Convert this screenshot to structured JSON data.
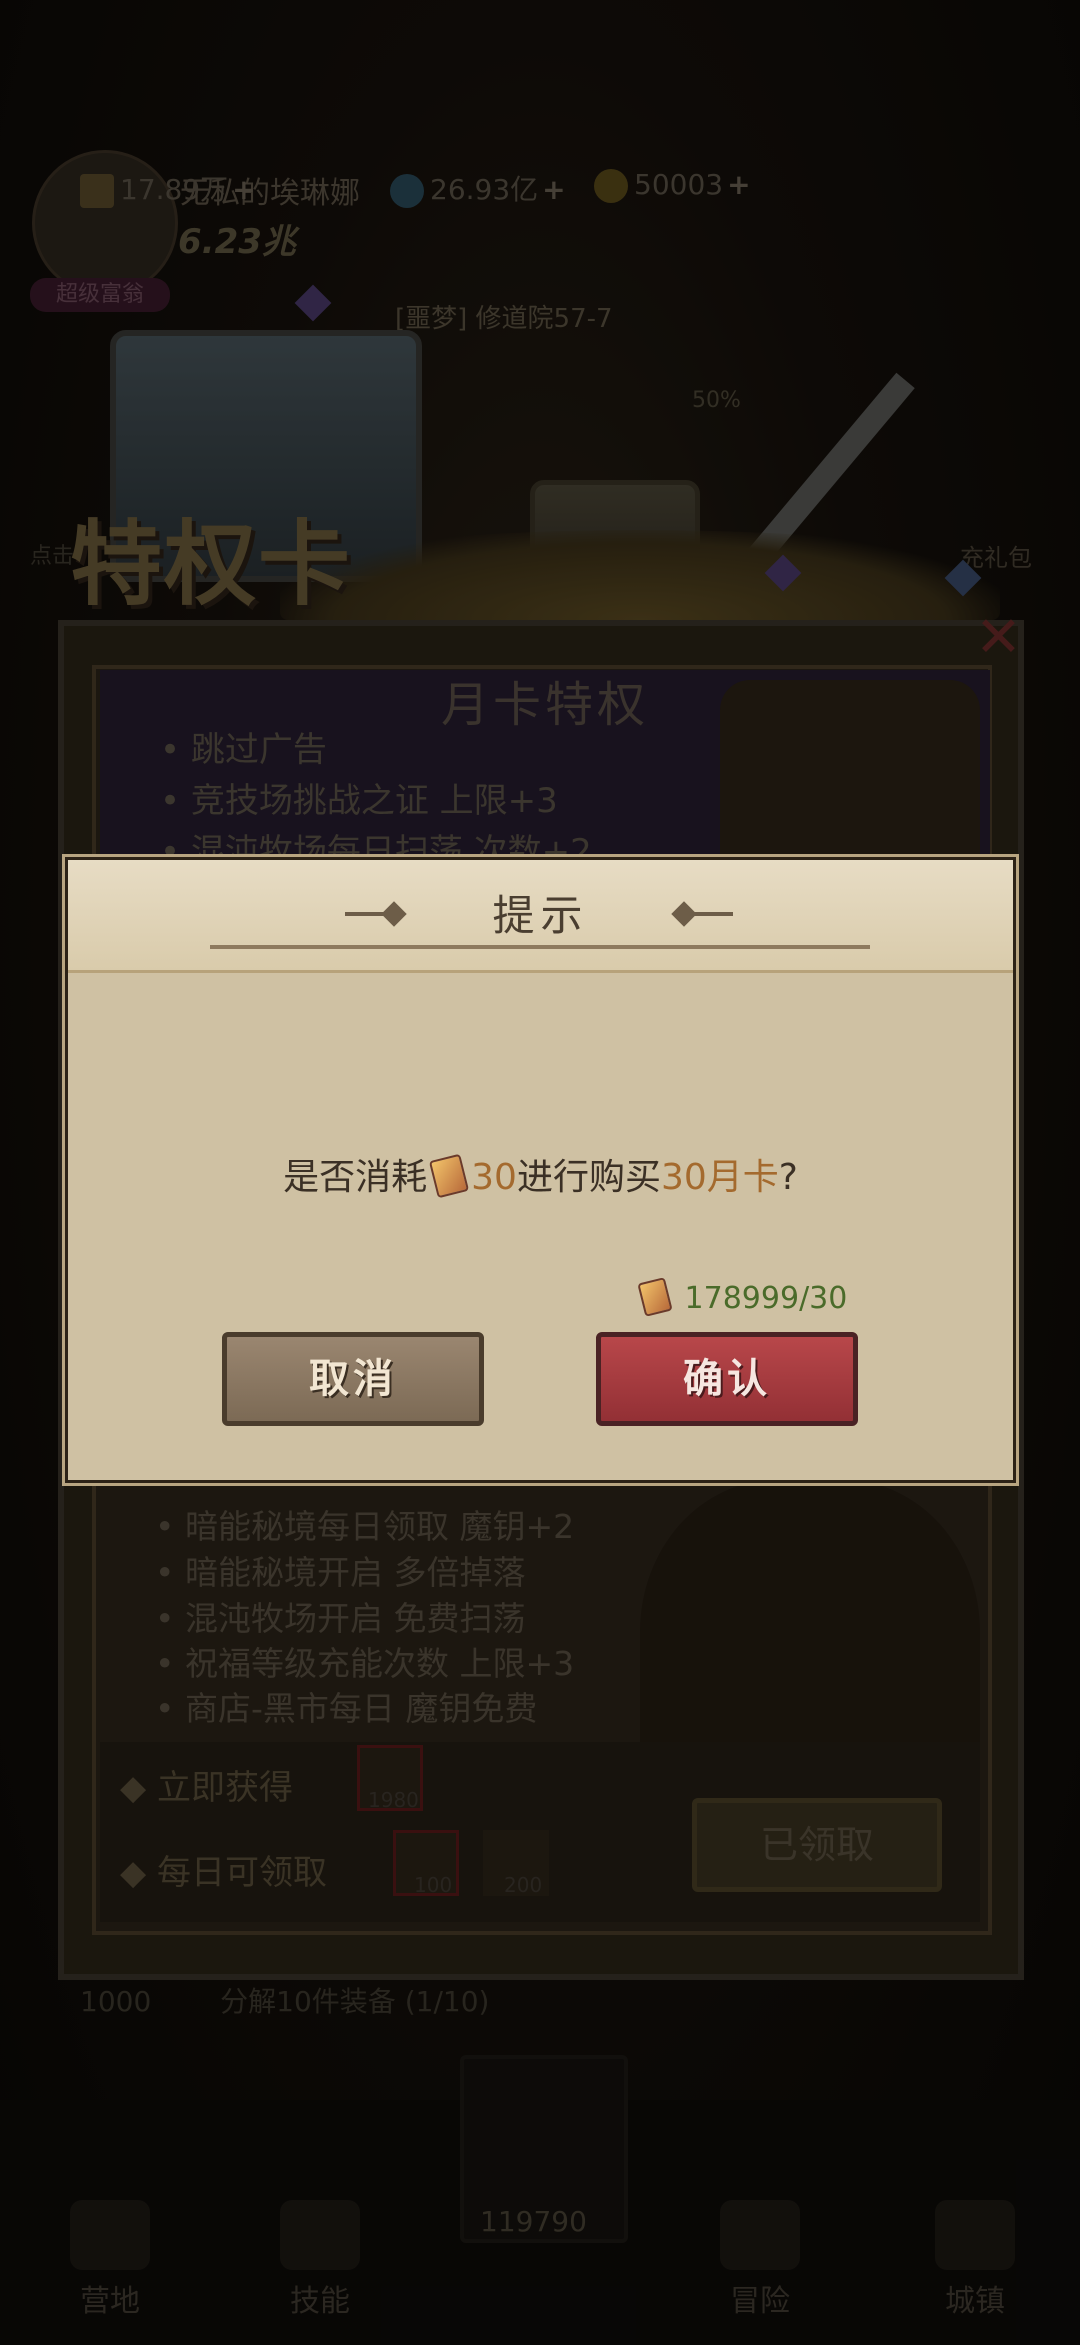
{
  "player": {
    "name": "无私的埃琳娜",
    "power": "6.23兆",
    "badge": "超级富翁",
    "tickets": "17.89万",
    "diamonds": "26.93亿",
    "coins": "50003"
  },
  "stage": "[噩梦] 修道院57-7",
  "stage_percent": "50%",
  "privilege_card": {
    "banner": "特权卡",
    "monthly_title": "月卡特权",
    "perks_top": [
      "跳过广告",
      "竞技场挑战之证 上限+3",
      "混沌牧场每日扫荡 次数+2"
    ],
    "perks_bottom": [
      "暗能秘境每日领取 魔钥+2",
      "暗能秘境开启 多倍掉落",
      "混沌牧场开启 免费扫荡",
      "祝福等级充能次数 上限+3",
      "商店-黑市每日 魔钥免费"
    ],
    "instant_label": "立即获得",
    "instant_reward": "1980",
    "daily_label": "每日可领取",
    "daily_rewards": [
      "100",
      "200"
    ],
    "claimed_button": "已领取",
    "close": "✕"
  },
  "dialog": {
    "title": "提示",
    "question_prefix": "是否消耗",
    "cost": "30",
    "question_mid": "进行购买",
    "item": "30月卡",
    "question_suffix": "?",
    "balance": "178999/30",
    "cancel": "取消",
    "confirm": "确认"
  },
  "task": {
    "label": "分解10件装备",
    "progress": "(1/10)",
    "reward": "1000"
  },
  "bottom_nav": {
    "items": [
      "营地",
      "技能",
      "冒险",
      "城镇"
    ],
    "center_value": "119790"
  },
  "side_labels": {
    "left": "点击",
    "right": "充礼包"
  },
  "colors": {
    "dialog_bg": "#cfc1a3",
    "confirm": "#b8474a",
    "cancel": "#8c7862",
    "highlight": "#a46a2e",
    "balance": "#4a6b2a"
  }
}
